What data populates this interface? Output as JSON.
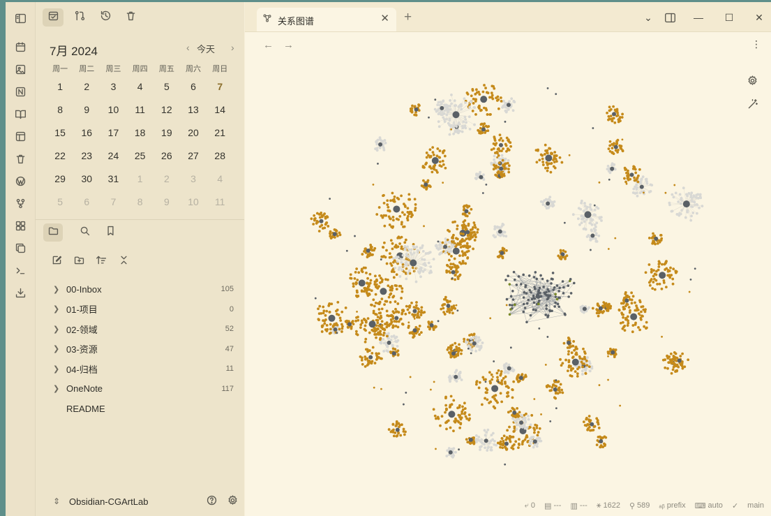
{
  "ribbon": {
    "icons": [
      "sidebar-toggle-icon",
      "calendar-icon",
      "image-icon",
      "notion-icon",
      "book-open-icon",
      "layout-icon",
      "trash-icon",
      "wordpress-icon",
      "git-icon",
      "dashboard-icon",
      "copy-icon",
      "terminal-icon",
      "import-icon"
    ]
  },
  "calendar": {
    "month_label": "7月 2024",
    "today_label": "今天",
    "weekdays": [
      "周一",
      "周二",
      "周三",
      "周四",
      "周五",
      "周六",
      "周日"
    ],
    "weeks": [
      [
        "1",
        "2",
        "3",
        "4",
        "5",
        "6",
        "7"
      ],
      [
        "8",
        "9",
        "10",
        "11",
        "12",
        "13",
        "14"
      ],
      [
        "15",
        "16",
        "17",
        "18",
        "19",
        "20",
        "21"
      ],
      [
        "22",
        "23",
        "24",
        "25",
        "26",
        "27",
        "28"
      ],
      [
        "29",
        "30",
        "31",
        "1",
        "2",
        "3",
        "4"
      ],
      [
        "5",
        "6",
        "7",
        "8",
        "9",
        "10",
        "11"
      ]
    ]
  },
  "files": {
    "items": [
      {
        "label": "00-Inbox",
        "count": "105"
      },
      {
        "label": "01-项目",
        "count": "0"
      },
      {
        "label": "02-领域",
        "count": "52"
      },
      {
        "label": "03-资源",
        "count": "47"
      },
      {
        "label": "04-归档",
        "count": "11"
      },
      {
        "label": "OneNote",
        "count": "117"
      },
      {
        "label": "README",
        "count": ""
      }
    ]
  },
  "vault": {
    "name": "Obsidian-CGArtLab"
  },
  "tab": {
    "title": "关系图谱"
  },
  "status": {
    "backlinks": "0",
    "words_a": "---",
    "words_b": "---",
    "nodes": "1622",
    "links": "589",
    "prefix": "prefix",
    "auto": "auto",
    "branch": "main"
  },
  "colors": {
    "accent": "#c58a1a",
    "node": "#5a6066",
    "node_light": "#d8d8d4",
    "selected": "#7a8a2a",
    "bg": "#fbf5e3"
  }
}
